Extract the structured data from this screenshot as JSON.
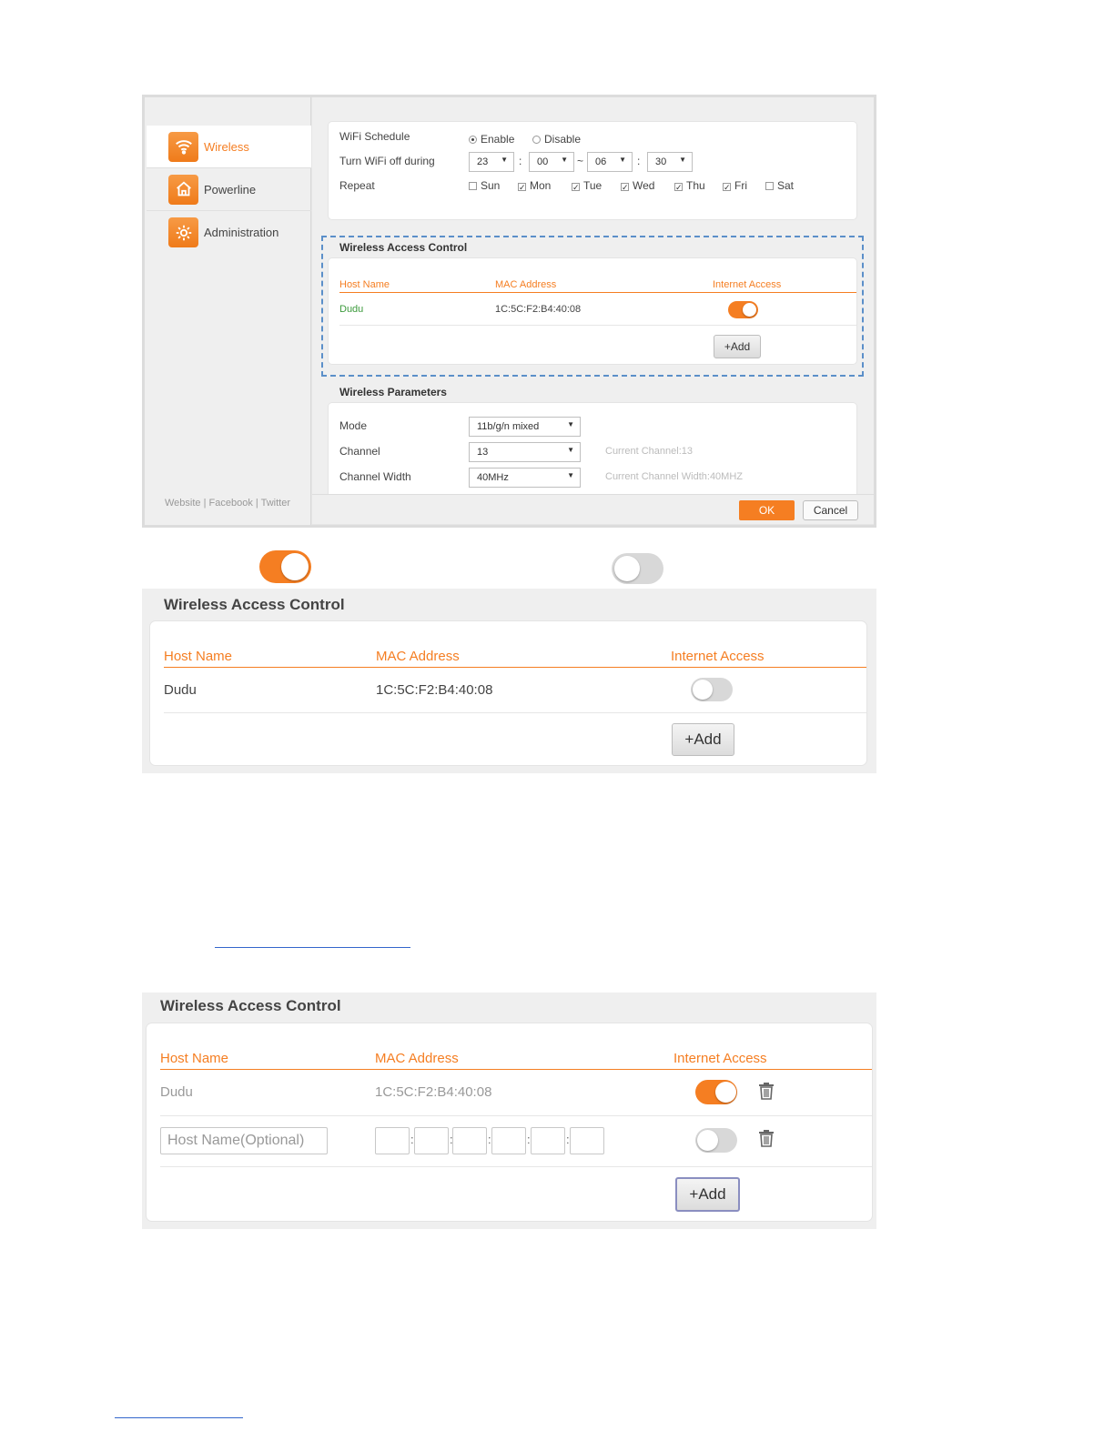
{
  "sidebar": {
    "items": [
      {
        "label": "Wireless",
        "icon": "wifi-icon"
      },
      {
        "label": "Powerline",
        "icon": "house-icon"
      },
      {
        "label": "Administration",
        "icon": "gear-icon"
      }
    ],
    "footer": {
      "website": "Website",
      "sep": "|",
      "facebook": "Facebook",
      "twitter": "Twitter"
    }
  },
  "schedule": {
    "label": "WiFi Schedule",
    "enable": "Enable",
    "disable": "Disable",
    "selected": "Enable",
    "off_label": "Turn WiFi off during",
    "start_hour": "23",
    "start_min": "00",
    "end_hour": "06",
    "end_min": "30",
    "colon": ":",
    "tilde": "~",
    "repeat_label": "Repeat",
    "days": [
      {
        "label": "Sun",
        "checked": false
      },
      {
        "label": "Mon",
        "checked": true
      },
      {
        "label": "Tue",
        "checked": true
      },
      {
        "label": "Wed",
        "checked": true
      },
      {
        "label": "Thu",
        "checked": true
      },
      {
        "label": "Fri",
        "checked": true
      },
      {
        "label": "Sat",
        "checked": false
      }
    ]
  },
  "access_control": {
    "title": "Wireless Access Control",
    "columns": {
      "host": "Host Name",
      "mac": "MAC Address",
      "internet": "Internet Access"
    },
    "rows": [
      {
        "host": "Dudu",
        "mac": "1C:5C:F2:B4:40:08",
        "internet": true
      }
    ],
    "add_label": "+Add"
  },
  "params": {
    "title": "Wireless Parameters",
    "mode_label": "Mode",
    "mode_value": "11b/g/n mixed",
    "channel_label": "Channel",
    "channel_value": "13",
    "channel_hint": "Current Channel:13",
    "width_label": "Channel Width",
    "width_value": "40MHz",
    "width_hint": "Current Channel Width:40MHZ"
  },
  "buttons": {
    "ok": "OK",
    "cancel": "Cancel"
  },
  "legend": {
    "on_state": true,
    "off_state": false
  },
  "access_control_off": {
    "title": "Wireless Access Control",
    "columns": {
      "host": "Host Name",
      "mac": "MAC Address",
      "internet": "Internet Access"
    },
    "rows": [
      {
        "host": "Dudu",
        "mac": "1C:5C:F2:B4:40:08",
        "internet": false
      }
    ],
    "add_label": "+Add"
  },
  "access_control_add": {
    "title": "Wireless Access Control",
    "columns": {
      "host": "Host Name",
      "mac": "MAC Address",
      "internet": "Internet Access"
    },
    "rows": [
      {
        "host": "Dudu",
        "mac": "1C:5C:F2:B4:40:08",
        "internet": true
      }
    ],
    "new_row": {
      "host_placeholder": "Host Name(Optional)",
      "internet": false
    },
    "add_label": "+Add"
  },
  "colors": {
    "accent": "#f57e22",
    "green": "#3c9a3c",
    "link": "#3366cc",
    "dashed": "#5b8fc9"
  }
}
